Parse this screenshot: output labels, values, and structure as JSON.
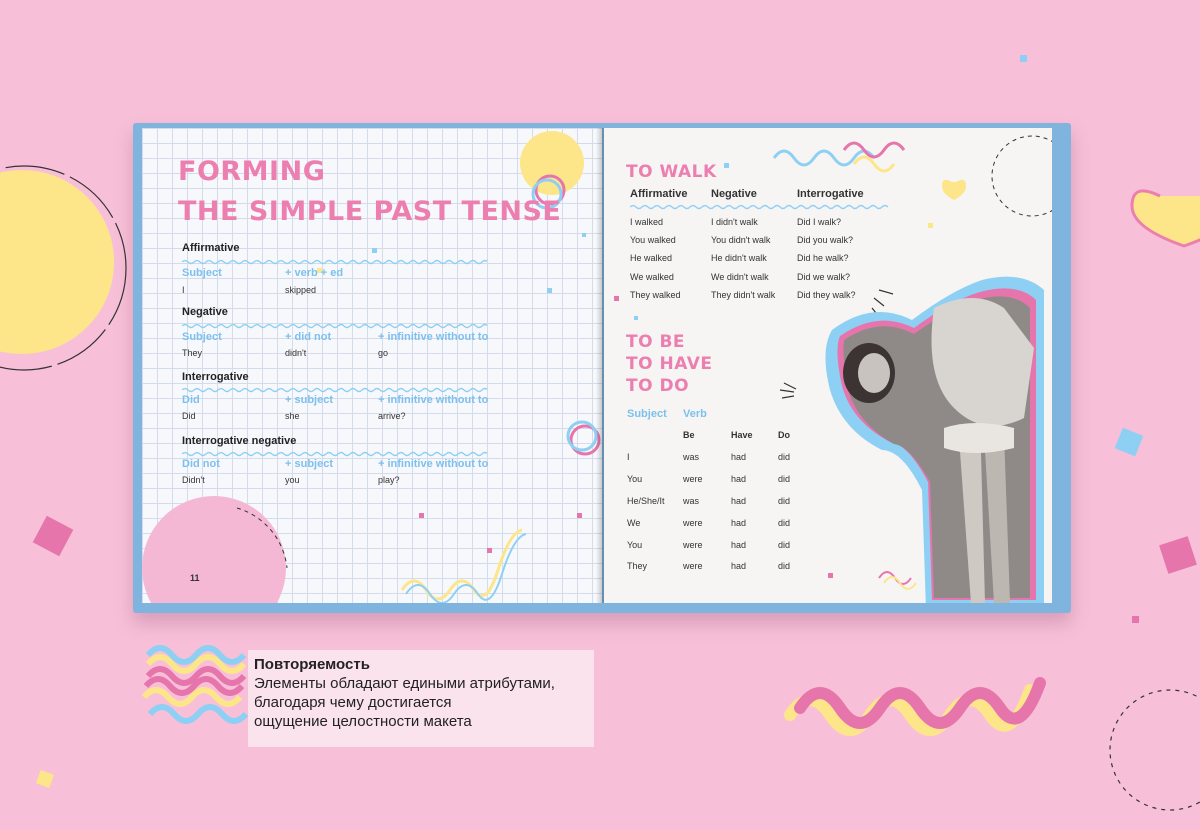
{
  "left_page": {
    "title_line1": "FORMING",
    "title_line2": "THE SIMPLE PAST TENSE",
    "page_number": "11",
    "sections": [
      {
        "heading": "Affirmative",
        "labels": [
          "Subject",
          "+ verb + ed"
        ],
        "values": [
          "I",
          "skipped"
        ]
      },
      {
        "heading": "Negative",
        "labels": [
          "Subject",
          "+ did not",
          "+ infinitive without to"
        ],
        "values": [
          "They",
          "didn't",
          "go"
        ]
      },
      {
        "heading": "Interrogative",
        "labels": [
          "Did",
          "+ subject",
          "+ infinitive without to"
        ],
        "values": [
          "Did",
          "she",
          "arrive?"
        ]
      },
      {
        "heading": "Interrogative negative",
        "labels": [
          "Did not",
          "+ subject",
          "+ infinitive without to"
        ],
        "values": [
          "Didn't",
          "you",
          "play?"
        ]
      }
    ]
  },
  "right_page": {
    "walk_title": "TO WALK",
    "walk_headers": [
      "Affirmative",
      "Negative",
      "Interrogative"
    ],
    "walk_rows": [
      [
        "I walked",
        "I didn't walk",
        "Did I walk?"
      ],
      [
        "You walked",
        "You didn't walk",
        "Did you walk?"
      ],
      [
        "He walked",
        "He didn't walk",
        "Did he walk?"
      ],
      [
        "We walked",
        "We didn't walk",
        "Did we walk?"
      ],
      [
        "They walked",
        "They didn't walk",
        "Did they walk?"
      ]
    ],
    "be_title": [
      "TO BE",
      "TO HAVE",
      "TO DO"
    ],
    "be_labels": [
      "Subject",
      "Verb"
    ],
    "be_subheaders": [
      "Be",
      "Have",
      "Do"
    ],
    "be_rows": [
      [
        "I",
        "was",
        "had",
        "did"
      ],
      [
        "You",
        "were",
        "had",
        "did"
      ],
      [
        "He/She/It",
        "was",
        "had",
        "did"
      ],
      [
        "We",
        "were",
        "had",
        "did"
      ],
      [
        "You",
        "were",
        "had",
        "did"
      ],
      [
        "They",
        "were",
        "had",
        "did"
      ]
    ],
    "photo_icon": "vintage-woman-photo"
  },
  "caption": {
    "title": "Повторяемость",
    "lines": [
      "Элементы обладают едиными атрибутами,",
      "благодаря чему достигается",
      "ощущение целостности макета"
    ]
  },
  "colors": {
    "background": "#f8c0d8",
    "pink": "#ec7fb0",
    "blue": "#7cc0ee",
    "yellow": "#fde68a",
    "cover": "#7fb4de"
  }
}
